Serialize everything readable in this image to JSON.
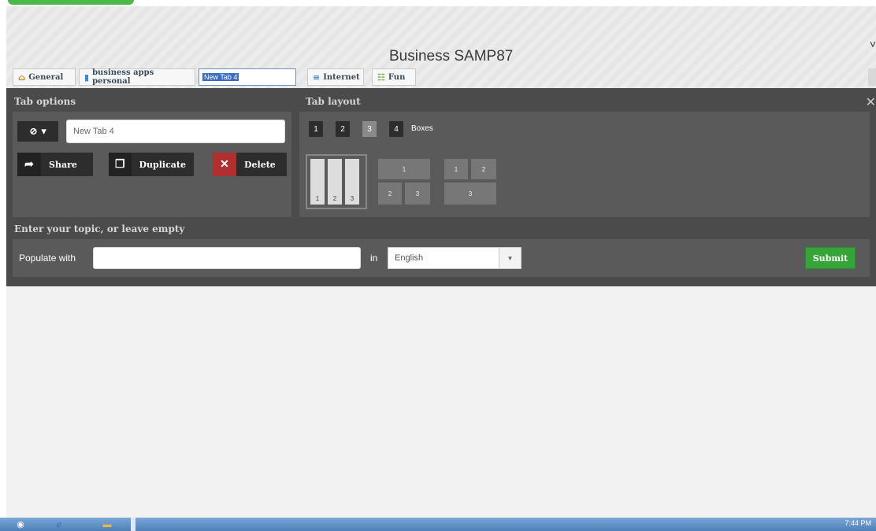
{
  "page": {
    "title": "Business SAMP87"
  },
  "tabs": [
    {
      "label": "General",
      "icon": "home-icon"
    },
    {
      "label": "business apps personal",
      "icon": "bar-chart-icon"
    },
    {
      "label": "New Tab 4",
      "icon": ""
    },
    {
      "label": "Internet",
      "icon": "internet-icon"
    },
    {
      "label": "Fun",
      "icon": "fun-icon"
    }
  ],
  "tab_options": {
    "title": "Tab options",
    "name_value": "New Tab 4",
    "share_label": "Share",
    "duplicate_label": "Duplicate",
    "delete_label": "Delete"
  },
  "tab_layout": {
    "title": "Tab layout",
    "columns": [
      "1",
      "2",
      "3",
      "4"
    ],
    "selected": "3",
    "boxes_label": "Boxes",
    "layout_numbers": {
      "one": "1",
      "two": "2",
      "three": "3"
    }
  },
  "topic": {
    "title": "Enter your topic, or leave empty",
    "populate_label": "Populate with",
    "populate_value": "",
    "in_label": "in",
    "language": "English",
    "submit_label": "Submit"
  },
  "taskbar": {
    "clock": "7:44 PM"
  },
  "colors": {
    "panel": "#4b4b4b",
    "submit": "#35a53a",
    "delete": "#b03030"
  }
}
